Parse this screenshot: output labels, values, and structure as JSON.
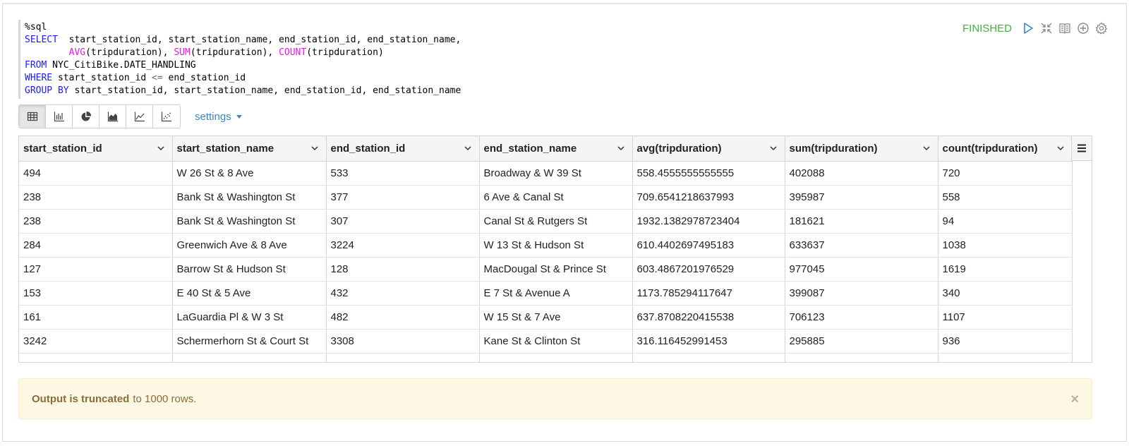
{
  "paragraph": {
    "status": "FINISHED",
    "code_lines": [
      [
        {
          "t": "%sql",
          "c": ""
        }
      ],
      [
        {
          "t": "SELECT",
          "c": "kw"
        },
        {
          "t": "  start_station_id, start_station_name, end_station_id, end_station_name,",
          "c": ""
        }
      ],
      [
        {
          "t": "        ",
          "c": ""
        },
        {
          "t": "AVG",
          "c": "fn"
        },
        {
          "t": "(tripduration), ",
          "c": ""
        },
        {
          "t": "SUM",
          "c": "fn"
        },
        {
          "t": "(tripduration), ",
          "c": ""
        },
        {
          "t": "COUNT",
          "c": "fn"
        },
        {
          "t": "(tripduration)",
          "c": ""
        }
      ],
      [
        {
          "t": "FROM",
          "c": "kw"
        },
        {
          "t": " NYC_CitiBike.DATE_HANDLING",
          "c": ""
        }
      ],
      [
        {
          "t": "WHERE",
          "c": "kw"
        },
        {
          "t": " start_station_id ",
          "c": ""
        },
        {
          "t": "<=",
          "c": "op"
        },
        {
          "t": " end_station_id",
          "c": ""
        }
      ],
      [
        {
          "t": "GROUP BY",
          "c": "kw"
        },
        {
          "t": " start_station_id, start_station_name, end_station_id, end_station_name",
          "c": ""
        }
      ]
    ]
  },
  "icons": {
    "run": "play-icon",
    "hide": "collapse-arrows-icon",
    "editor": "book-icon",
    "add": "plus-circle-icon",
    "settings": "gear-icon"
  },
  "toolbar": {
    "settings_label": "settings",
    "vis_buttons": [
      "table-icon",
      "bar-chart-icon",
      "pie-chart-icon",
      "area-chart-icon",
      "line-chart-icon",
      "scatter-chart-icon"
    ]
  },
  "table": {
    "columns": [
      "start_station_id",
      "start_station_name",
      "end_station_id",
      "end_station_name",
      "avg(tripduration)",
      "sum(tripduration)",
      "count(tripduration)"
    ],
    "rows": [
      [
        "494",
        "W 26 St & 8 Ave",
        "533",
        "Broadway & W 39 St",
        "558.4555555555555",
        "402088",
        "720"
      ],
      [
        "238",
        "Bank St & Washington St",
        "377",
        "6 Ave & Canal St",
        "709.6541218637993",
        "395987",
        "558"
      ],
      [
        "238",
        "Bank St & Washington St",
        "307",
        "Canal St & Rutgers St",
        "1932.1382978723404",
        "181621",
        "94"
      ],
      [
        "284",
        "Greenwich Ave & 8 Ave",
        "3224",
        "W 13 St & Hudson St",
        "610.4402697495183",
        "633637",
        "1038"
      ],
      [
        "127",
        "Barrow St & Hudson St",
        "128",
        "MacDougal St & Prince St",
        "603.4867201976529",
        "977045",
        "1619"
      ],
      [
        "153",
        "E 40 St & 5 Ave",
        "432",
        "E 7 St & Avenue A",
        "1173.785294117647",
        "399087",
        "340"
      ],
      [
        "161",
        "LaGuardia Pl & W 3 St",
        "482",
        "W 15 St & 7 Ave",
        "637.8708220415538",
        "706123",
        "1107"
      ],
      [
        "3242",
        "Schermerhorn St & Court St",
        "3308",
        "Kane St & Clinton St",
        "316.116452991453",
        "295885",
        "936"
      ]
    ]
  },
  "alert": {
    "bold": "Output is truncated",
    "rest": "to 1000 rows.",
    "close": "×"
  },
  "colors": {
    "status_finished": "#3cb33c",
    "keyword": "#1a1aff",
    "function": "#e61ae6",
    "link": "#3a86c8",
    "alert_bg": "#fcf8e3",
    "alert_text": "#8a6d3b"
  }
}
